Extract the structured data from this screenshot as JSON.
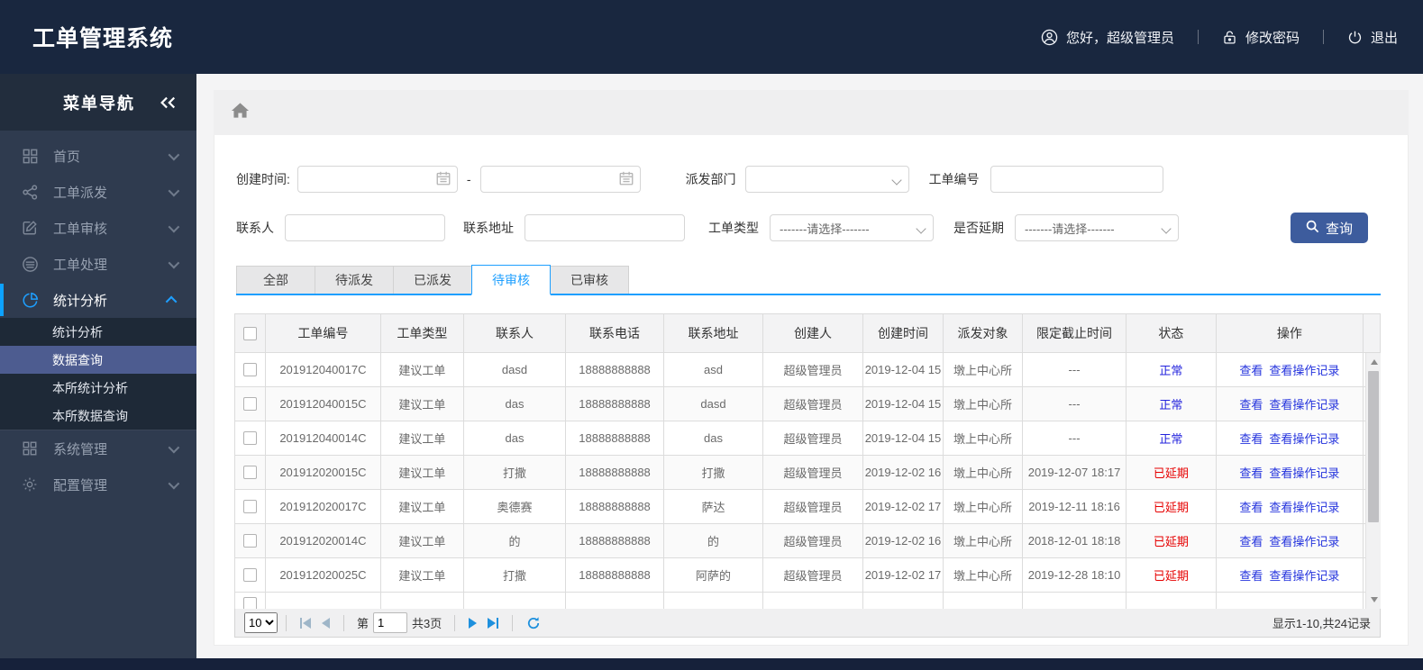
{
  "colors": {
    "header_bg": "#19273f",
    "sidebar_bg": "#2f3b4f",
    "accent_blue": "#1e9fff",
    "active_submenu_bg": "#4d5c90",
    "search_button_bg": "#3d5c9d",
    "link_blue": "#2433dd",
    "status_normal": "#2323dd",
    "status_delayed": "#e60000"
  },
  "header": {
    "title": "工单管理系统",
    "greeting": "您好，超级管理员",
    "greeting_icon": "user-circle-icon",
    "change_password": "修改密码",
    "change_password_icon": "lock-icon",
    "logout": "退出",
    "logout_icon": "power-icon"
  },
  "sidebar": {
    "title": "菜单导航",
    "collapse_icon": "double-chevron-left-icon",
    "items": [
      {
        "label": "首页",
        "icon": "grid-icon"
      },
      {
        "label": "工单派发",
        "icon": "share-icon"
      },
      {
        "label": "工单审核",
        "icon": "edit-icon"
      },
      {
        "label": "工单处理",
        "icon": "layers-icon"
      },
      {
        "label": "统计分析",
        "icon": "pie-chart-icon",
        "active": true,
        "children": [
          "统计分析",
          "数据查询",
          "本所统计分析",
          "本所数据查询"
        ],
        "active_child": "数据查询"
      },
      {
        "label": "系统管理",
        "icon": "grid-icon"
      },
      {
        "label": "配置管理",
        "icon": "gear-icon"
      }
    ]
  },
  "breadcrumb": {
    "home_icon": "home-icon"
  },
  "filters": {
    "create_time_label": "创建时间:",
    "range_separator": "-",
    "date_icon": "calendar-icon",
    "dispatch_dept_label": "派发部门",
    "order_no_label": "工单编号",
    "contact_label": "联系人",
    "address_label": "联系地址",
    "order_type_label": "工单类型",
    "delay_label": "是否延期",
    "select_placeholder": "-------请选择-------",
    "search_button": "查询",
    "search_icon": "search-icon"
  },
  "tabs": [
    {
      "label": "全部"
    },
    {
      "label": "待派发"
    },
    {
      "label": "已派发"
    },
    {
      "label": "待审核",
      "active": true
    },
    {
      "label": "已审核"
    }
  ],
  "table": {
    "columns": [
      "工单编号",
      "工单类型",
      "联系人",
      "联系电话",
      "联系地址",
      "创建人",
      "创建时间",
      "派发对象",
      "限定截止时间",
      "状态",
      "操作"
    ],
    "actions": [
      "查看",
      "查看操作记录"
    ],
    "rows": [
      {
        "order_no": "201912040017C",
        "type": "建议工单",
        "contact": "dasd",
        "phone": "18888888888",
        "address": "asd",
        "creator": "超级管理员",
        "created": "2019-12-04 15",
        "target": "墩上中心所",
        "deadline": "---",
        "status": "正常",
        "status_type": "normal"
      },
      {
        "order_no": "201912040015C",
        "type": "建议工单",
        "contact": "das",
        "phone": "18888888888",
        "address": "dasd",
        "creator": "超级管理员",
        "created": "2019-12-04 15",
        "target": "墩上中心所",
        "deadline": "---",
        "status": "正常",
        "status_type": "normal"
      },
      {
        "order_no": "201912040014C",
        "type": "建议工单",
        "contact": "das",
        "phone": "18888888888",
        "address": "das",
        "creator": "超级管理员",
        "created": "2019-12-04 15",
        "target": "墩上中心所",
        "deadline": "---",
        "status": "正常",
        "status_type": "normal"
      },
      {
        "order_no": "201912020015C",
        "type": "建议工单",
        "contact": "打撒",
        "phone": "18888888888",
        "address": "打撒",
        "creator": "超级管理员",
        "created": "2019-12-02 16",
        "target": "墩上中心所",
        "deadline": "2019-12-07 18:17",
        "status": "已延期",
        "status_type": "delayed"
      },
      {
        "order_no": "201912020017C",
        "type": "建议工单",
        "contact": "奥德赛",
        "phone": "18888888888",
        "address": "萨达",
        "creator": "超级管理员",
        "created": "2019-12-02 17",
        "target": "墩上中心所",
        "deadline": "2019-12-11 18:16",
        "status": "已延期",
        "status_type": "delayed"
      },
      {
        "order_no": "201912020014C",
        "type": "建议工单",
        "contact": "的",
        "phone": "18888888888",
        "address": "的",
        "creator": "超级管理员",
        "created": "2019-12-02 16",
        "target": "墩上中心所",
        "deadline": "2018-12-01 18:18",
        "status": "已延期",
        "status_type": "delayed"
      },
      {
        "order_no": "201912020025C",
        "type": "建议工单",
        "contact": "打撒",
        "phone": "18888888888",
        "address": "阿萨的",
        "creator": "超级管理员",
        "created": "2019-12-02 17",
        "target": "墩上中心所",
        "deadline": "2019-12-28 18:10",
        "status": "已延期",
        "status_type": "delayed"
      }
    ]
  },
  "pagination": {
    "page_size": "10",
    "page_prefix": "第",
    "page_value": "1",
    "total_pages": "共3页",
    "summary": "显示1-10,共24记录"
  }
}
